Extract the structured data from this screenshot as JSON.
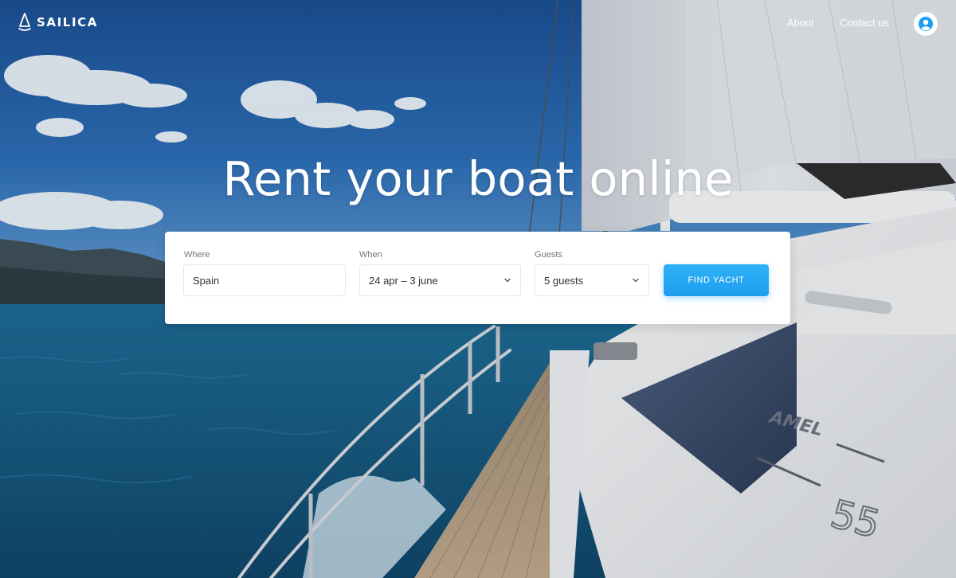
{
  "brand": {
    "name": "SAILICA"
  },
  "nav": {
    "items": [
      {
        "label": "About"
      },
      {
        "label": "Contact us"
      }
    ]
  },
  "hero": {
    "headline": "Rent your boat online",
    "hull_text_model": "AMEL",
    "hull_text_number": "55"
  },
  "search": {
    "where": {
      "label": "Where",
      "value": "Spain"
    },
    "when": {
      "label": "When",
      "value": "24 apr – 3 june"
    },
    "guests": {
      "label": "Guests",
      "value": "5 guests"
    },
    "submit_label": "FIND YACHT"
  },
  "icons": {
    "logo": "sail-logo-icon",
    "avatar": "user-avatar-icon",
    "dropdown": "chevron-down-icon"
  },
  "colors": {
    "accent": "#1d9eef",
    "card": "#ffffff",
    "label": "#6d7680",
    "field_border": "#e4e7eb"
  }
}
